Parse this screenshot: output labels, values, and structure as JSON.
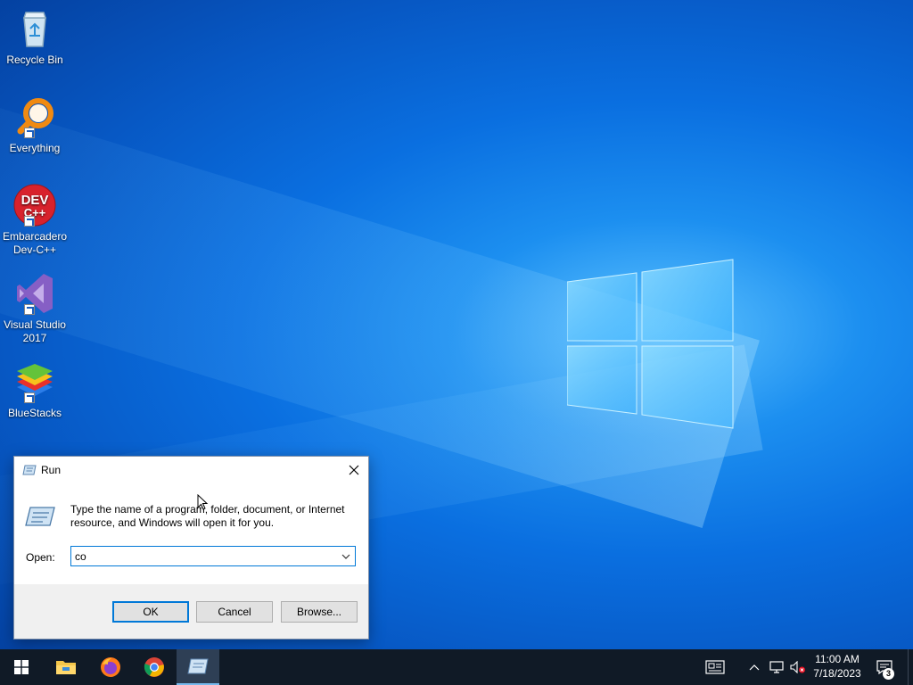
{
  "desktop": {
    "icons": [
      {
        "label": "Recycle Bin",
        "icon": "recycle-bin-icon"
      },
      {
        "label": "Everything",
        "icon": "everything-search-icon"
      },
      {
        "label": "Embarcadero Dev-C++",
        "icon": "devcpp-icon",
        "icon_text": "DEV C++"
      },
      {
        "label": "Visual Studio 2017",
        "icon": "visual-studio-icon"
      },
      {
        "label": "BlueStacks",
        "icon": "bluestacks-icon"
      }
    ]
  },
  "run_dialog": {
    "title": "Run",
    "description": "Type the name of a program, folder, document, or Internet resource, and Windows will open it for you.",
    "open_label": "Open:",
    "open_value": "co",
    "buttons": {
      "ok": "OK",
      "cancel": "Cancel",
      "browse": "Browse..."
    }
  },
  "taskbar": {
    "pinned": [
      "start-icon",
      "file-explorer-icon",
      "firefox-icon",
      "chrome-icon",
      "run-icon"
    ],
    "clock": {
      "time": "11:00 AM",
      "date": "7/18/2023"
    },
    "notification_count": "3",
    "tray": [
      "news-icon",
      "chevron-up-icon",
      "network-icon",
      "volume-muted-icon",
      "notification-icon"
    ]
  },
  "colors": {
    "accent": "#0078d7",
    "taskbar": "#101a26",
    "dialog_bg": "#f0f0f0"
  }
}
